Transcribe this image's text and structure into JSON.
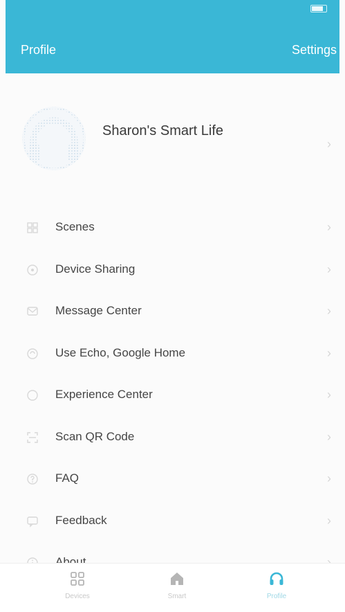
{
  "status_bar": {
    "carrier": "",
    "time": "",
    "battery": ""
  },
  "nav": {
    "title": "Profile",
    "settings_label": "Settings"
  },
  "profile": {
    "name": "Sharon's Smart Life",
    "avatar_icon": "headphones-avatar-icon"
  },
  "menu": [
    {
      "label": "Scenes",
      "icon": "scenes-icon"
    },
    {
      "label": "Device Sharing",
      "icon": "device-sharing-icon"
    },
    {
      "label": "Message Center",
      "icon": "message-center-icon"
    },
    {
      "label": "Use Echo, Google Home",
      "icon": "echo-google-home-icon"
    },
    {
      "label": "Experience Center",
      "icon": "experience-center-icon"
    },
    {
      "label": "Scan QR Code",
      "icon": "scan-qr-icon"
    },
    {
      "label": "FAQ",
      "icon": "faq-icon"
    },
    {
      "label": "Feedback",
      "icon": "feedback-icon"
    },
    {
      "label": "About",
      "icon": "about-icon"
    }
  ],
  "chevron": "›",
  "tabs": [
    {
      "label": "Devices",
      "icon": "grid-icon",
      "active": false
    },
    {
      "label": "Smart",
      "icon": "home-icon",
      "active": false
    },
    {
      "label": "Profile",
      "icon": "headphones-icon",
      "active": true
    }
  ],
  "colors": {
    "accent": "#3ab7d6",
    "active_tab": "#9fd8e6",
    "text": "#454545"
  }
}
